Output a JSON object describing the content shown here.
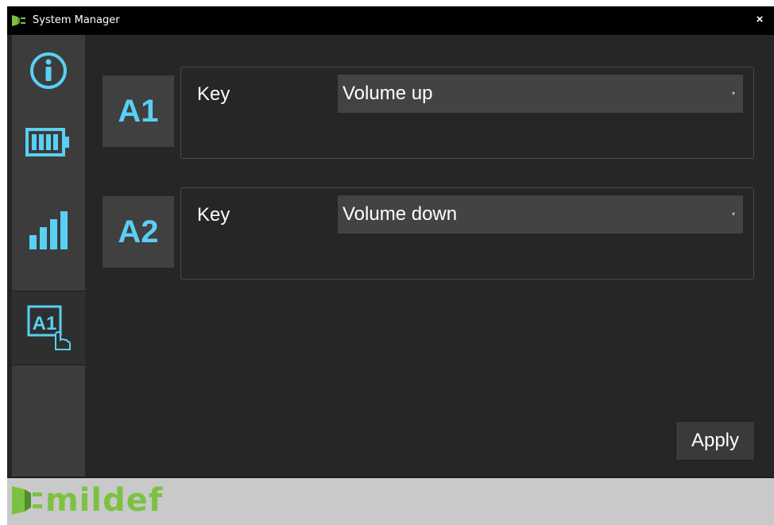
{
  "window": {
    "title": "System Manager",
    "close_glyph": "×"
  },
  "sidebar": {
    "items": [
      {
        "name": "info",
        "icon": "info-icon"
      },
      {
        "name": "battery",
        "icon": "battery-icon"
      },
      {
        "name": "signal",
        "icon": "signal-bars-icon"
      },
      {
        "name": "key-assignment",
        "icon": "a1-key-touch-icon",
        "icon_text": "A1",
        "selected": true
      }
    ]
  },
  "main": {
    "keys": [
      {
        "tag": "A1",
        "label": "Key",
        "value": "Volume up"
      },
      {
        "tag": "A2",
        "label": "Key",
        "value": "Volume down"
      }
    ],
    "dropdown_arrow": "▾",
    "apply_label": "Apply"
  },
  "footer": {
    "logo_text": "mildef"
  },
  "colors": {
    "accent": "#59d0f3",
    "brand_green": "#7cc242",
    "background": "#262626",
    "sidebar": "#3c3c3c",
    "footer": "#c9c9c9"
  }
}
